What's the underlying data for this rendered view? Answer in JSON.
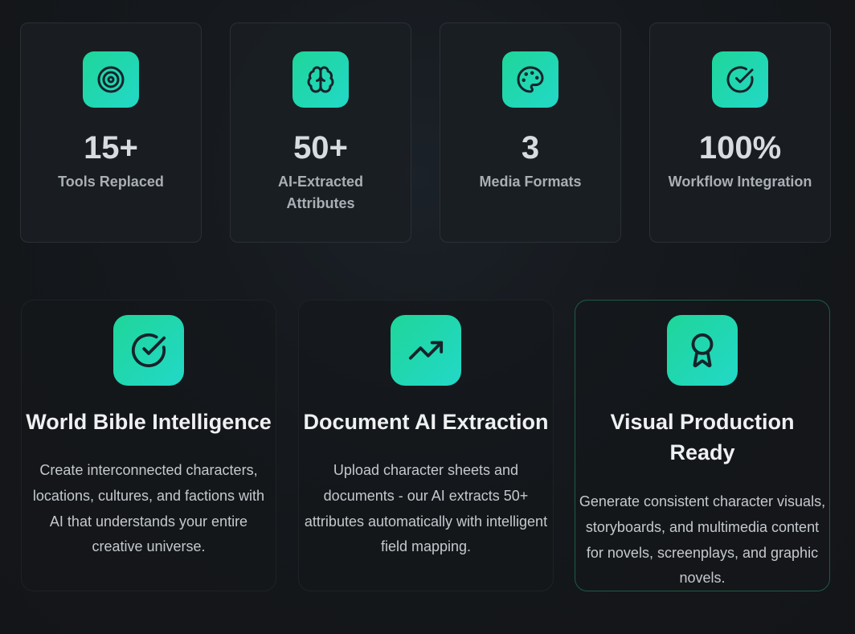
{
  "stats": [
    {
      "icon": "target-icon",
      "value": "15+",
      "label": "Tools Replaced"
    },
    {
      "icon": "brain-icon",
      "value": "50+",
      "label": "AI-Extracted Attributes"
    },
    {
      "icon": "palette-icon",
      "value": "3",
      "label": "Media Formats"
    },
    {
      "icon": "check-circle-icon",
      "value": "100%",
      "label": "Workflow Integration"
    }
  ],
  "features": [
    {
      "icon": "check-circle-icon",
      "title": "World Bible Intelligence",
      "description": "Create interconnected characters, locations, cultures, and factions with AI that understands your entire creative universe."
    },
    {
      "icon": "trending-up-icon",
      "title": "Document AI Extraction",
      "description": "Upload character sheets and documents - our AI extracts 50+ attributes automatically with intelligent field mapping."
    },
    {
      "icon": "award-ribbon-icon",
      "title": "Visual Production Ready",
      "description": "Generate consistent character visuals, storyboards, and multimedia content for novels, screenplays, and graphic novels."
    }
  ],
  "colors": {
    "accent_start": "#1fd699",
    "accent_end": "#22d8c8",
    "background": "#15181c",
    "highlight_border": "#1f5a46"
  }
}
